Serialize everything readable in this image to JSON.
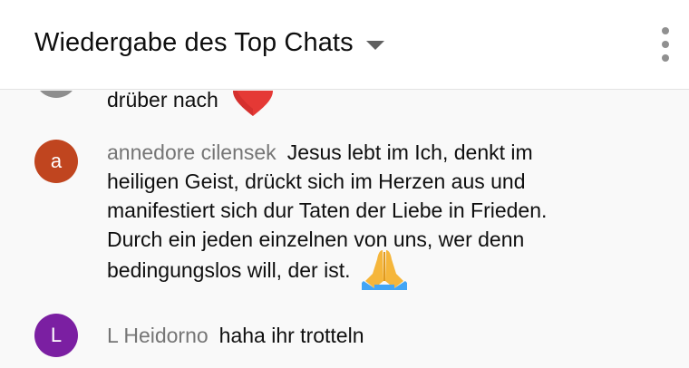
{
  "header": {
    "title": "Wiedergabe des Top Chats"
  },
  "messages": [
    {
      "author": "",
      "text": "drüber nach",
      "emoji": "red-heart"
    },
    {
      "author": "annedore cilensek",
      "avatar_letter": "a",
      "avatar_color": "#c0451f",
      "text_lines": [
        "Jesus lebt im Ich, denkt im",
        "heiligen Geist, drückt sich im Herzen aus und",
        "manifestiert sich dur Taten der Liebe in Frieden.",
        "Durch ein jeden einzelnen von uns, wer denn",
        "bedingungslos will, der ist."
      ],
      "emoji": "folded-hands"
    },
    {
      "author": "L Heidorno",
      "avatar_letter": "L",
      "avatar_color": "#7b1fa2",
      "text": "haha ihr trotteln"
    }
  ]
}
